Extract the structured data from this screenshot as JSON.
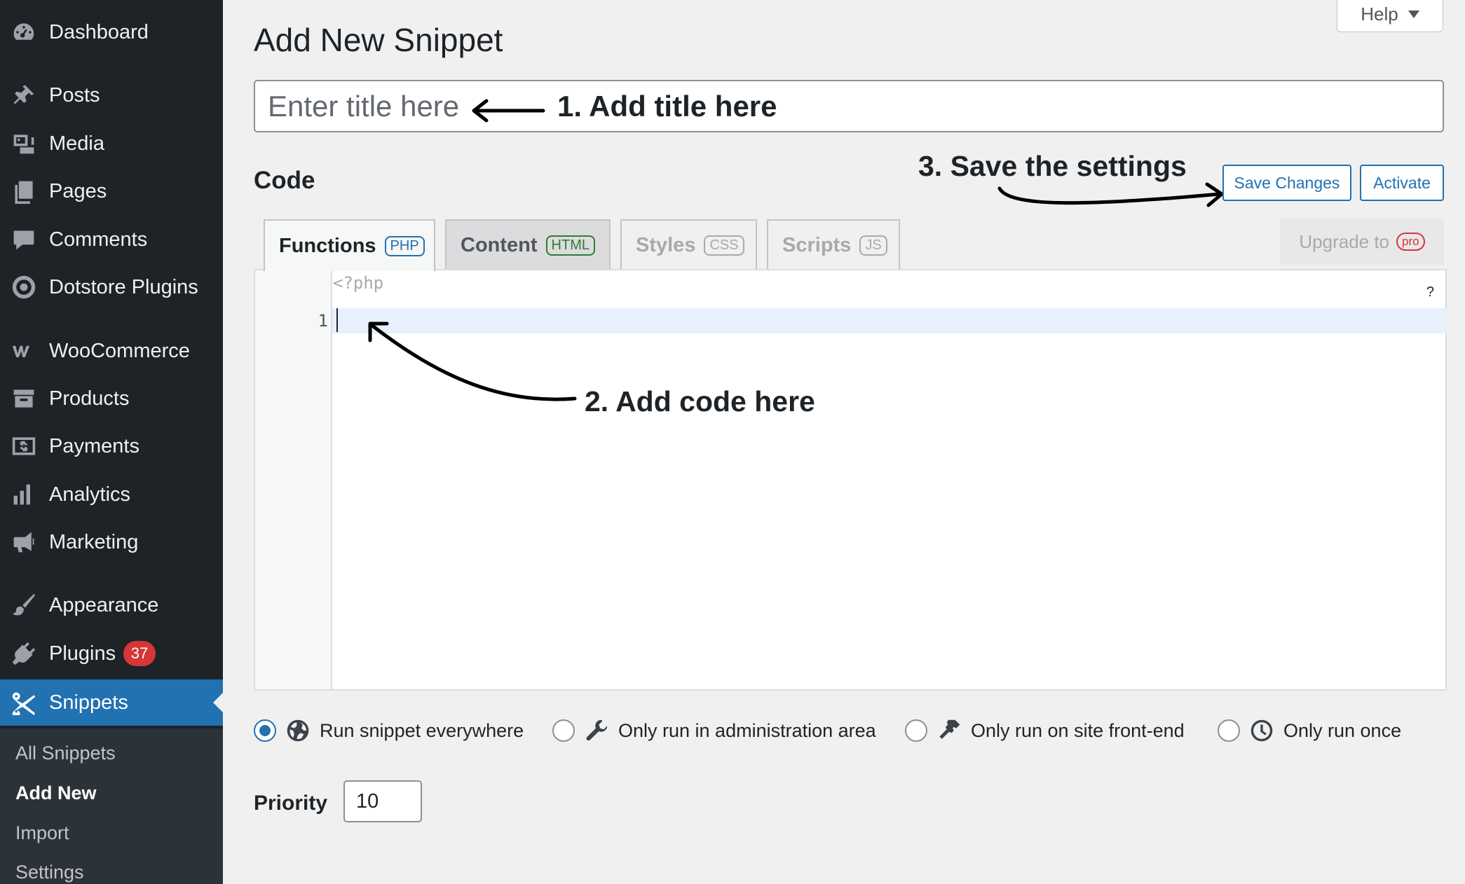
{
  "sidebar": {
    "items": [
      {
        "label": "Dashboard",
        "icon": "dashboard-icon"
      },
      {
        "label": "Posts",
        "icon": "pin-icon"
      },
      {
        "label": "Media",
        "icon": "media-icon"
      },
      {
        "label": "Pages",
        "icon": "pages-icon"
      },
      {
        "label": "Comments",
        "icon": "comment-icon"
      },
      {
        "label": "Dotstore Plugins",
        "icon": "dotstore-icon"
      },
      {
        "label": "WooCommerce",
        "icon": "woo-icon"
      },
      {
        "label": "Products",
        "icon": "archive-icon"
      },
      {
        "label": "Payments",
        "icon": "dollar-icon"
      },
      {
        "label": "Analytics",
        "icon": "bar-chart-icon"
      },
      {
        "label": "Marketing",
        "icon": "megaphone-icon"
      },
      {
        "label": "Appearance",
        "icon": "brush-icon"
      },
      {
        "label": "Plugins",
        "icon": "plug-icon",
        "badge": "37"
      },
      {
        "label": "Snippets",
        "icon": "scissors-icon",
        "active": true
      }
    ],
    "submenu": [
      "All Snippets",
      "Add New",
      "Import",
      "Settings"
    ],
    "current_submenu": "Add New"
  },
  "help_label": "Help",
  "page_title": "Add New Snippet",
  "title_input": {
    "placeholder": "Enter title here",
    "value": ""
  },
  "annotations": {
    "step1": "1. Add title here",
    "step2": "2. Add code here",
    "step3": "3. Save the settings"
  },
  "code_heading": "Code",
  "buttons": {
    "save": "Save Changes",
    "activate": "Activate"
  },
  "tabs": [
    {
      "label": "Functions",
      "tag": "PHP",
      "active": true
    },
    {
      "label": "Content",
      "tag": "HTML"
    },
    {
      "label": "Styles",
      "tag": "CSS"
    },
    {
      "label": "Scripts",
      "tag": "JS"
    }
  ],
  "upgrade": {
    "label": "Upgrade to",
    "tag": "pro"
  },
  "editor": {
    "php_open": "<?php",
    "line_number": "1",
    "help": "?"
  },
  "scope_options": [
    {
      "label": "Run snippet everywhere",
      "icon": "globe-icon",
      "checked": true
    },
    {
      "label": "Only run in administration area",
      "icon": "wrench-icon",
      "checked": false
    },
    {
      "label": "Only run on site front-end",
      "icon": "hammer-icon",
      "checked": false
    },
    {
      "label": "Only run once",
      "icon": "clock-icon",
      "checked": false
    }
  ],
  "priority": {
    "label": "Priority",
    "value": "10"
  },
  "colors": {
    "sidebar": "#1d2327",
    "accent": "#2271b1",
    "badge": "#d63638",
    "page_bg": "#f0f0f1"
  }
}
